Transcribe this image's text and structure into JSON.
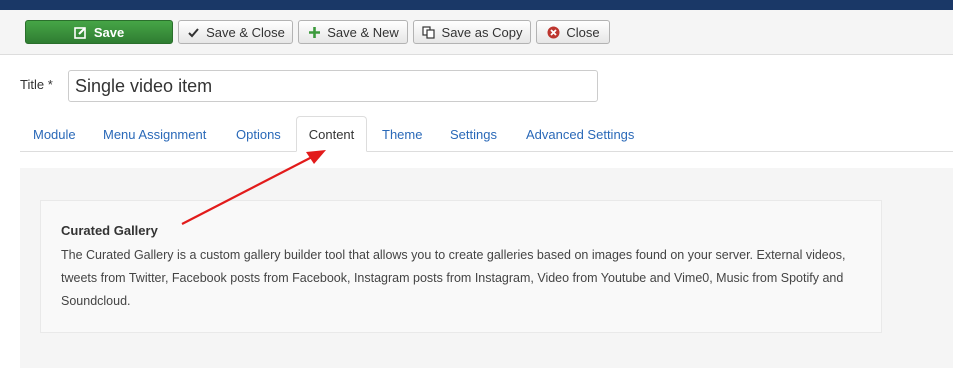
{
  "toolbar": {
    "save_label": "Save",
    "save_close_label": "Save & Close",
    "save_new_label": "Save & New",
    "save_copy_label": "Save as Copy",
    "close_label": "Close"
  },
  "form": {
    "title_label": "Title *",
    "title_value": "Single video item"
  },
  "tabs": [
    {
      "label": "Module"
    },
    {
      "label": "Menu Assignment"
    },
    {
      "label": "Options"
    },
    {
      "label": "Content",
      "active": true
    },
    {
      "label": "Theme"
    },
    {
      "label": "Settings"
    },
    {
      "label": "Advanced Settings"
    }
  ],
  "content": {
    "heading": "Curated Gallery",
    "description": "The Curated Gallery is a custom gallery builder tool that allows you to create galleries based on images found on your server. External videos, tweets from Twitter, Facebook posts from Facebook, Instagram posts from Instagram, Video from Youtube and Vime0, Music from Spotify and Soundcloud."
  },
  "colors": {
    "header_bar": "#1a3867",
    "save_button": "#3c9a3c",
    "link": "#2a69b8",
    "annotation_arrow": "#e21b1b"
  }
}
